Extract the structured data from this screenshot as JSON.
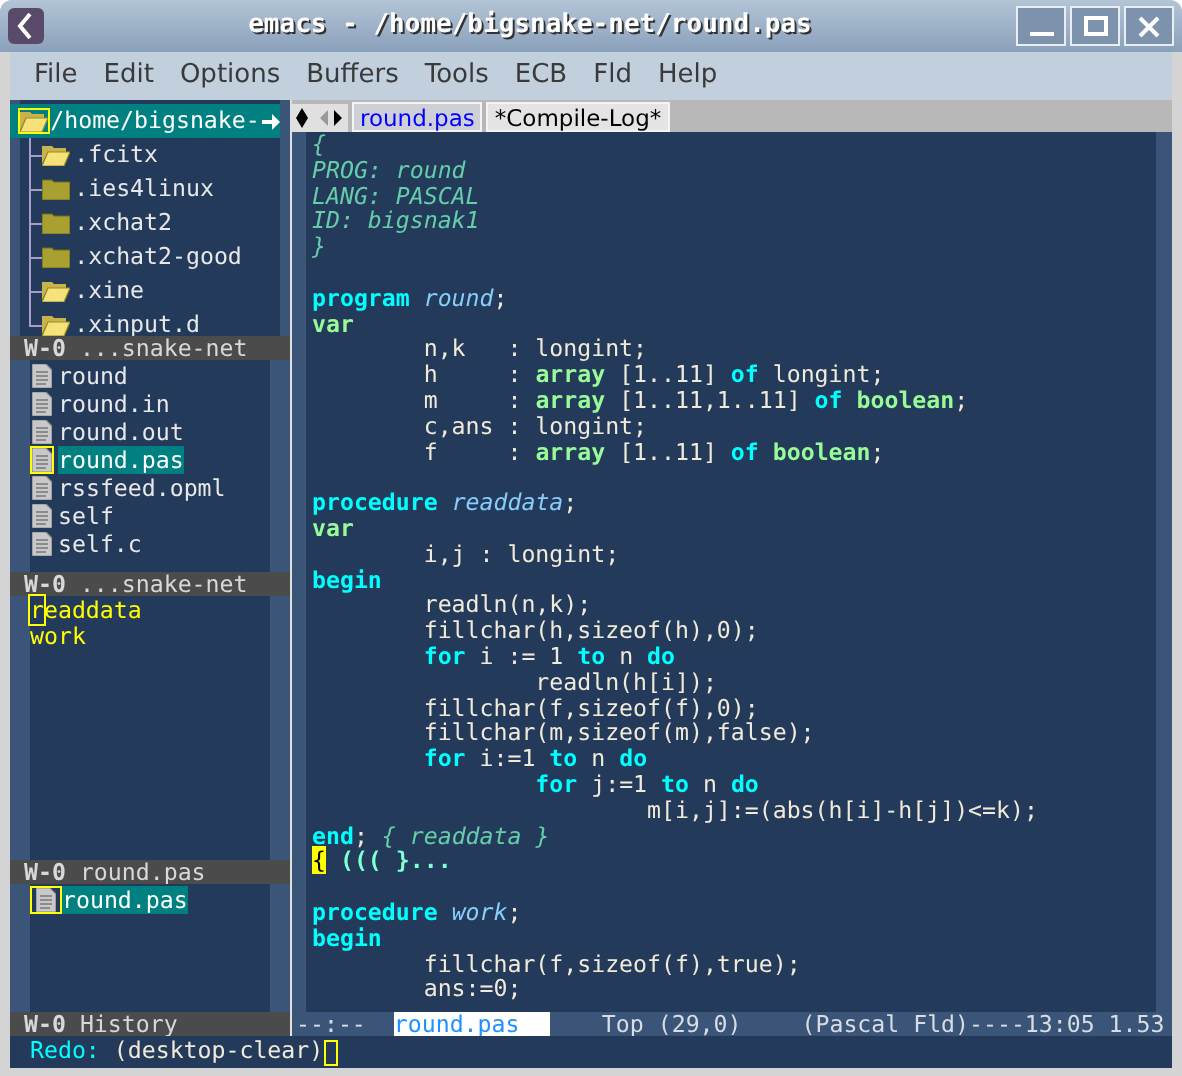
{
  "window": {
    "title": "emacs - /home/bigsnake-net/round.pas"
  },
  "menu": [
    "File",
    "Edit",
    "Options",
    "Buffers",
    "Tools",
    "ECB",
    "Fld",
    "Help"
  ],
  "directories": {
    "root": {
      "label": "/home/bigsnake-",
      "selected": true
    },
    "items": [
      {
        "label": ".fcitx",
        "kind": "open"
      },
      {
        "label": ".ies4linux",
        "kind": "closed"
      },
      {
        "label": ".xchat2",
        "kind": "closed"
      },
      {
        "label": ".xchat2-good",
        "kind": "closed"
      },
      {
        "label": ".xine",
        "kind": "open"
      },
      {
        "label": ".xinput.d",
        "kind": "open"
      }
    ],
    "modeline": {
      "window": "W-0",
      "name": "...snake-net"
    }
  },
  "sources": {
    "items": [
      {
        "label": "round",
        "selected": false
      },
      {
        "label": "round.in",
        "selected": false
      },
      {
        "label": "round.out",
        "selected": false
      },
      {
        "label": "round.pas",
        "selected": true
      },
      {
        "label": "rssfeed.opml",
        "selected": false
      },
      {
        "label": "self",
        "selected": false
      },
      {
        "label": "self.c",
        "selected": false
      }
    ],
    "modeline": {
      "window": "W-0",
      "name": "...snake-net"
    }
  },
  "methods": {
    "items": [
      {
        "label": "readdata",
        "cursor": true
      },
      {
        "label": "work",
        "cursor": false
      }
    ],
    "modeline": {
      "window": "W-0",
      "name": "round.pas"
    }
  },
  "history": {
    "items": [
      {
        "label": "round.pas",
        "selected": true
      }
    ],
    "modeline": {
      "window": "W-0",
      "name": "History"
    }
  },
  "tabs": [
    {
      "label": "round.pas",
      "selected": true
    },
    {
      "label": "*Compile-Log*",
      "selected": false
    }
  ],
  "code": [
    {
      "kind": "code",
      "segments": [
        {
          "kind": "comment",
          "text": "{"
        }
      ]
    },
    {
      "kind": "code",
      "segments": [
        {
          "kind": "comment",
          "text": "PROG: round"
        }
      ]
    },
    {
      "kind": "code",
      "segments": [
        {
          "kind": "comment",
          "text": "LANG: PASCAL"
        }
      ]
    },
    {
      "kind": "code",
      "segments": [
        {
          "kind": "comment",
          "text": "ID: bigsnak1"
        }
      ]
    },
    {
      "kind": "code",
      "segments": [
        {
          "kind": "comment",
          "text": "}"
        }
      ]
    },
    {
      "kind": "blank"
    },
    {
      "kind": "code",
      "segments": [
        {
          "kind": "keyword",
          "text": "program "
        },
        {
          "kind": "name",
          "text": "round"
        },
        {
          "kind": "plain",
          "text": ";"
        }
      ]
    },
    {
      "kind": "code",
      "segments": [
        {
          "kind": "type",
          "text": "var"
        }
      ]
    },
    {
      "kind": "code",
      "segments": [
        {
          "kind": "plain",
          "text": "        n,k   : longint;"
        }
      ]
    },
    {
      "kind": "code",
      "segments": [
        {
          "kind": "plain",
          "text": "        h     : "
        },
        {
          "kind": "type",
          "text": "array"
        },
        {
          "kind": "plain",
          "text": " [1..11] "
        },
        {
          "kind": "keyword",
          "text": "of"
        },
        {
          "kind": "plain",
          "text": " longint;"
        }
      ]
    },
    {
      "kind": "code",
      "segments": [
        {
          "kind": "plain",
          "text": "        m     : "
        },
        {
          "kind": "type",
          "text": "array"
        },
        {
          "kind": "plain",
          "text": " [1..11,1..11] "
        },
        {
          "kind": "keyword",
          "text": "of "
        },
        {
          "kind": "type",
          "text": "boolean"
        },
        {
          "kind": "plain",
          "text": ";"
        }
      ]
    },
    {
      "kind": "code",
      "segments": [
        {
          "kind": "plain",
          "text": "        c,ans : longint;"
        }
      ]
    },
    {
      "kind": "code",
      "segments": [
        {
          "kind": "plain",
          "text": "        f     : "
        },
        {
          "kind": "type",
          "text": "array"
        },
        {
          "kind": "plain",
          "text": " [1..11] "
        },
        {
          "kind": "keyword",
          "text": "of "
        },
        {
          "kind": "type",
          "text": "boolean"
        },
        {
          "kind": "plain",
          "text": ";"
        }
      ]
    },
    {
      "kind": "blank"
    },
    {
      "kind": "code",
      "segments": [
        {
          "kind": "keyword",
          "text": "procedure "
        },
        {
          "kind": "name",
          "text": "readdata"
        },
        {
          "kind": "plain",
          "text": ";"
        }
      ]
    },
    {
      "kind": "code",
      "segments": [
        {
          "kind": "type",
          "text": "var"
        }
      ]
    },
    {
      "kind": "code",
      "segments": [
        {
          "kind": "plain",
          "text": "        i,j : longint;"
        }
      ]
    },
    {
      "kind": "code",
      "segments": [
        {
          "kind": "keyword",
          "text": "begin"
        }
      ]
    },
    {
      "kind": "code",
      "segments": [
        {
          "kind": "plain",
          "text": "        readln(n,k);"
        }
      ]
    },
    {
      "kind": "code",
      "segments": [
        {
          "kind": "plain",
          "text": "        fillchar(h,sizeof(h),0);"
        }
      ]
    },
    {
      "kind": "code",
      "segments": [
        {
          "kind": "keyword",
          "text": "        for"
        },
        {
          "kind": "plain",
          "text": " i := 1 "
        },
        {
          "kind": "keyword",
          "text": "to"
        },
        {
          "kind": "plain",
          "text": " n "
        },
        {
          "kind": "keyword",
          "text": "do"
        }
      ]
    },
    {
      "kind": "code",
      "segments": [
        {
          "kind": "plain",
          "text": "                readln(h[i]);"
        }
      ]
    },
    {
      "kind": "code",
      "segments": [
        {
          "kind": "plain",
          "text": "        fillchar(f,sizeof(f),0);"
        }
      ]
    },
    {
      "kind": "code",
      "segments": [
        {
          "kind": "plain",
          "text": "        fillchar(m,sizeof(m),false);"
        }
      ]
    },
    {
      "kind": "code",
      "segments": [
        {
          "kind": "keyword",
          "text": "        for"
        },
        {
          "kind": "plain",
          "text": " i:=1 "
        },
        {
          "kind": "keyword",
          "text": "to"
        },
        {
          "kind": "plain",
          "text": " n "
        },
        {
          "kind": "keyword",
          "text": "do"
        }
      ]
    },
    {
      "kind": "code",
      "segments": [
        {
          "kind": "keyword",
          "text": "                for"
        },
        {
          "kind": "plain",
          "text": " j:=1 "
        },
        {
          "kind": "keyword",
          "text": "to"
        },
        {
          "kind": "plain",
          "text": " n "
        },
        {
          "kind": "keyword",
          "text": "do"
        }
      ]
    },
    {
      "kind": "code",
      "segments": [
        {
          "kind": "plain",
          "text": "                        m[i,j]:=(abs(h[i]-h[j])<=k);"
        }
      ]
    },
    {
      "kind": "code",
      "segments": [
        {
          "kind": "keyword",
          "text": "end"
        },
        {
          "kind": "plain",
          "text": "; "
        },
        {
          "kind": "comment",
          "text": "{ readdata }"
        }
      ]
    },
    {
      "kind": "code",
      "segments": [
        {
          "kind": "cursor",
          "text": "{"
        },
        {
          "kind": "fold",
          "text": " ((( }..."
        }
      ]
    },
    {
      "kind": "blank"
    },
    {
      "kind": "code",
      "segments": [
        {
          "kind": "keyword",
          "text": "procedure "
        },
        {
          "kind": "name",
          "text": "work"
        },
        {
          "kind": "plain",
          "text": ";"
        }
      ]
    },
    {
      "kind": "code",
      "segments": [
        {
          "kind": "keyword",
          "text": "begin"
        }
      ]
    },
    {
      "kind": "code",
      "segments": [
        {
          "kind": "plain",
          "text": "        fillchar(f,sizeof(f),true);"
        }
      ]
    },
    {
      "kind": "code",
      "segments": [
        {
          "kind": "plain",
          "text": "        ans:=0;"
        }
      ]
    }
  ],
  "modeline": {
    "status": "--:--",
    "buffer": "round.pas",
    "position": "Top",
    "cursor": "(29,0)",
    "mode": "(Pascal Fld)----13:05 1.53"
  },
  "minibuffer": {
    "prompt": "Redo:",
    "text": "(desktop-clear)"
  }
}
